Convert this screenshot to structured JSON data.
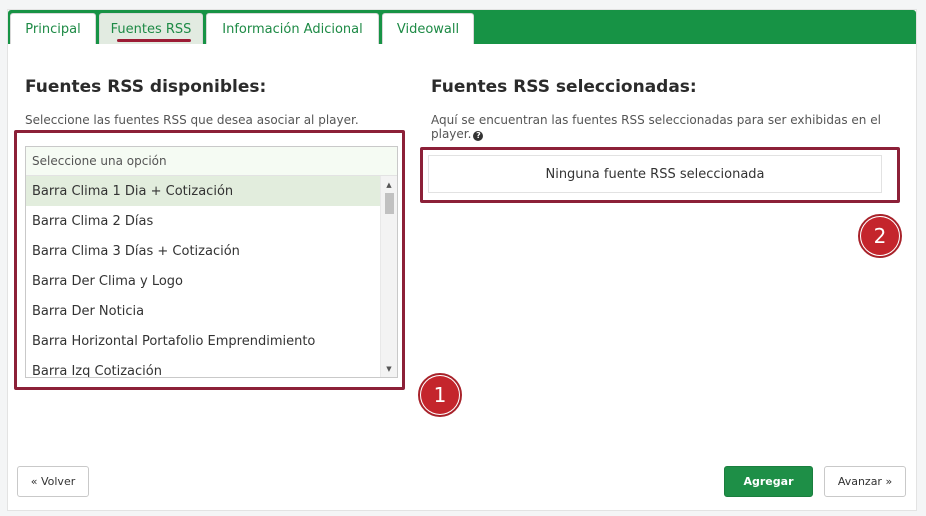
{
  "tabs": [
    {
      "label": "Principal"
    },
    {
      "label": "Fuentes RSS"
    },
    {
      "label": "Información Adicional"
    },
    {
      "label": "Videowall"
    }
  ],
  "available": {
    "title": "Fuentes RSS disponibles:",
    "description": "Seleccione las fuentes RSS que desea asociar al player.",
    "placeholder": "Seleccione una opción",
    "options": [
      "Barra Clima 1 Dia + Cotización",
      "Barra Clima 2 Días",
      "Barra Clima 3 Días + Cotización",
      "Barra Der Clima y Logo",
      "Barra Der Noticia",
      "Barra Horizontal Portafolio Emprendimiento",
      "Barra Izq Cotización"
    ]
  },
  "selected": {
    "title": "Fuentes RSS seleccionadas:",
    "description": "Aquí se encuentran las fuentes RSS seleccionadas para ser exhibidas en el player.",
    "empty_text": "Ninguna fuente RSS seleccionada"
  },
  "markers": [
    "1",
    "2"
  ],
  "buttons": {
    "back": "« Volver",
    "add": "Agregar",
    "next": "Avanzar »"
  },
  "colors": {
    "brand_green": "#179345",
    "accent_red": "#8c2038",
    "marker_red": "#c4252c"
  }
}
